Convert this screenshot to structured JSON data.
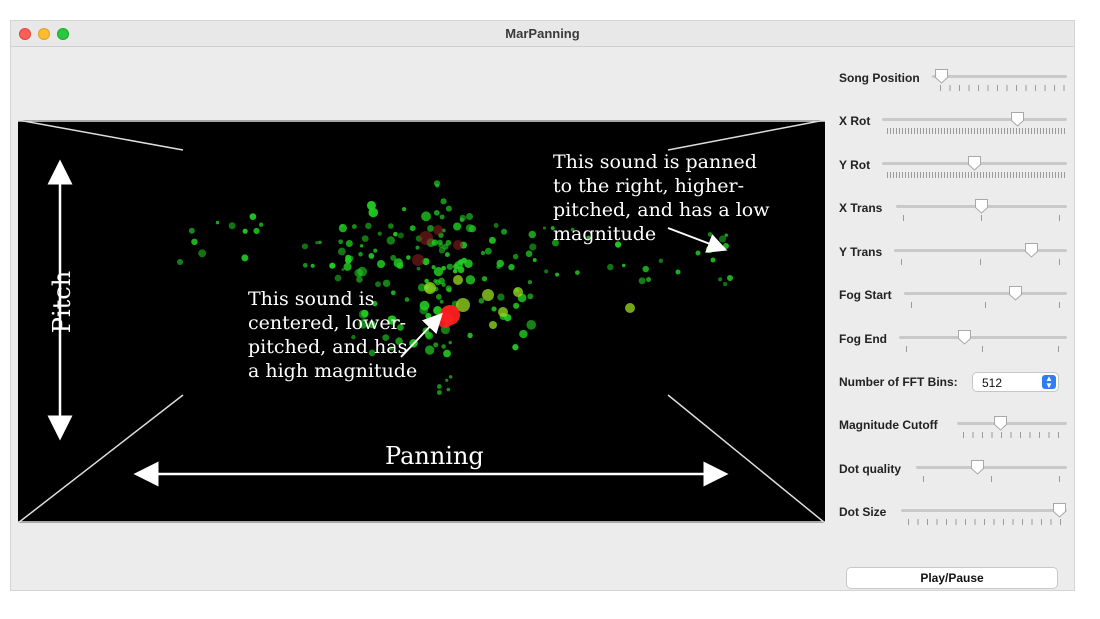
{
  "window": {
    "title": "MarPanning"
  },
  "visualization": {
    "axis_labels": {
      "pitch": "Pitch",
      "panning": "Panning"
    },
    "annotations": {
      "right": "This sound is panned\nto the right, higher-\npitched, and has a low\nmagnitude",
      "center": "This sound is\ncentered, lower-\npitched, and has\na high magnitude"
    },
    "colors": {
      "background": "#000000",
      "dot_low": "#22cc22",
      "dot_mid": "#99dd22",
      "dot_high": "#ff2020"
    }
  },
  "controls": {
    "sliders": [
      {
        "label": "Song Position",
        "value": 0.02
      },
      {
        "label": "X Rot",
        "value": 0.75
      },
      {
        "label": "Y Rot",
        "value": 0.5
      },
      {
        "label": "X Trans",
        "value": 0.5
      },
      {
        "label": "Y Trans",
        "value": 0.82
      },
      {
        "label": "Fog Start",
        "value": 0.7
      },
      {
        "label": "Fog End",
        "value": 0.38
      },
      {
        "label": "Magnitude Cutoff",
        "value": 0.38
      },
      {
        "label": "Dot quality",
        "value": 0.4
      },
      {
        "label": "Dot Size",
        "value": 1.0
      }
    ],
    "fft_bins": {
      "label": "Number of FFT Bins:",
      "value": "512"
    },
    "play_pause_label": "Play/Pause"
  }
}
